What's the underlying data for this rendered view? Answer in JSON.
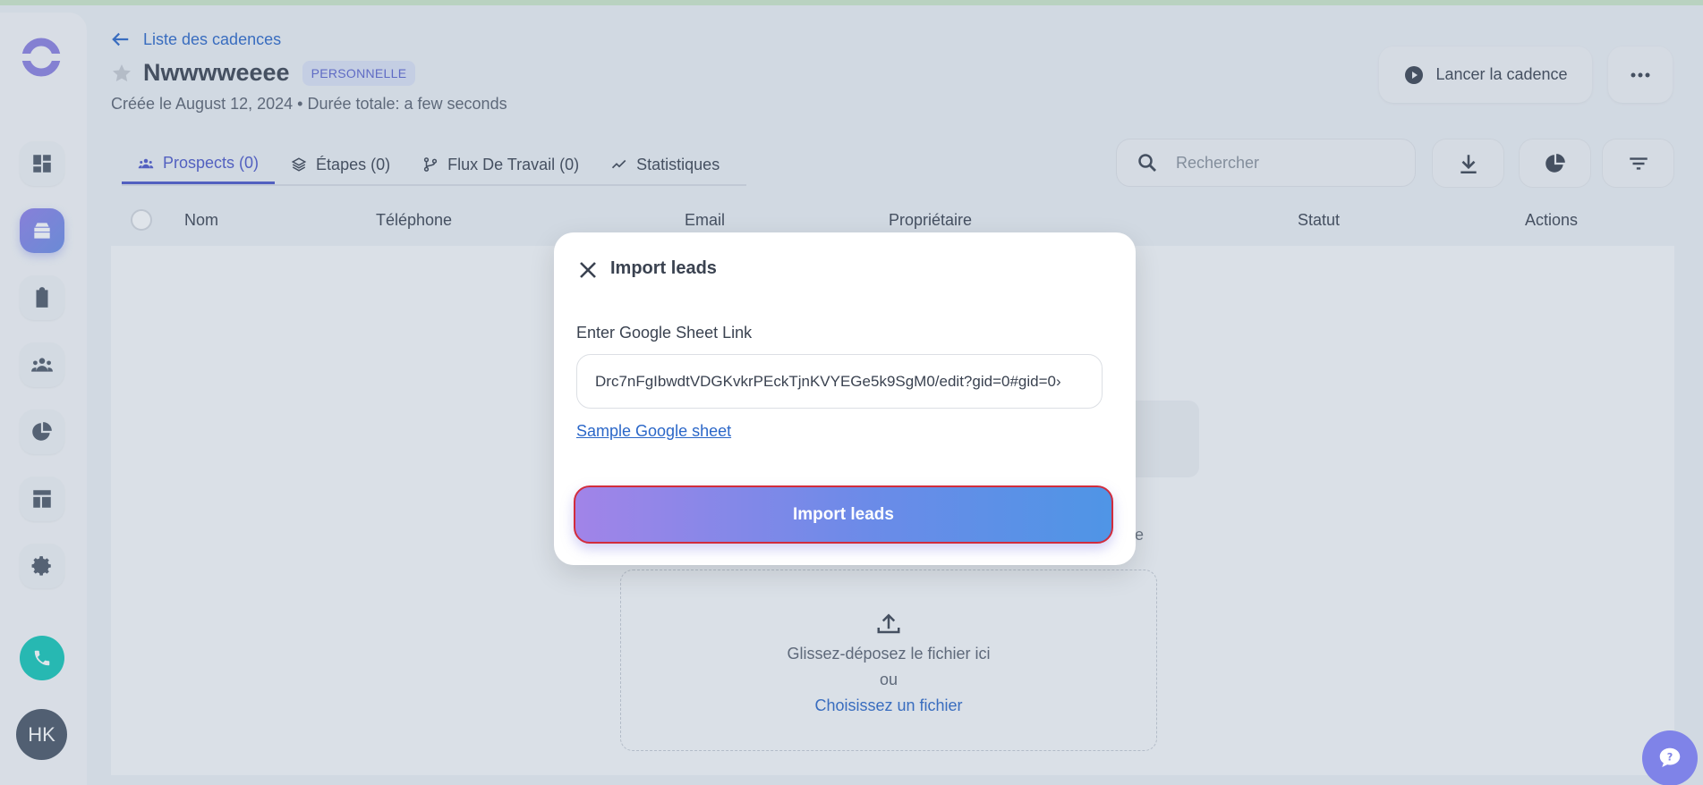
{
  "header": {
    "back_label": "Liste des cadences",
    "title": "Nwwwweeee",
    "badge": "PERSONNELLE",
    "subtitle": "Créée le August 12, 2024 • Durée totale: a few seconds",
    "launch_label": "Lancer la cadence"
  },
  "tabs": [
    {
      "label": "Prospects (0)",
      "icon": "users-icon",
      "active": true
    },
    {
      "label": "Étapes (0)",
      "icon": "layers-icon",
      "active": false
    },
    {
      "label": "Flux De Travail (0)",
      "icon": "git-branch-icon",
      "active": false
    },
    {
      "label": "Statistiques",
      "icon": "trend-icon",
      "active": false
    }
  ],
  "search": {
    "placeholder": "Rechercher"
  },
  "table": {
    "columns": [
      "Nom",
      "Téléphone",
      "Email",
      "Propriétaire",
      "Statut",
      "Actions"
    ]
  },
  "background": {
    "partial_text": "e",
    "dropzone_line1": "Glissez-déposez le fichier ici",
    "dropzone_line2": "ou",
    "dropzone_link": "Choisissez un fichier"
  },
  "sidebar": {
    "avatar_initials": "HK",
    "items": [
      "dashboard-icon",
      "cadences-icon",
      "tasks-icon",
      "team-icon",
      "reports-icon",
      "templates-icon",
      "settings-icon"
    ]
  },
  "modal": {
    "title": "Import leads",
    "field_label": "Enter Google Sheet Link",
    "field_value": "‹Drc7nFgIbwdtVDGKvkrPEckTjnKVYEGe5k9SgM0/edit?gid=0#gid=0",
    "sample_link": "Sample Google sheet",
    "submit_label": "Import leads"
  },
  "colors": {
    "accent": "#4b57c9",
    "link": "#2b67c8",
    "phone": "#14c7b8",
    "button_gradient_start": "#a184e8",
    "button_gradient_end": "#4f95e6",
    "button_border": "#d12c3d"
  }
}
